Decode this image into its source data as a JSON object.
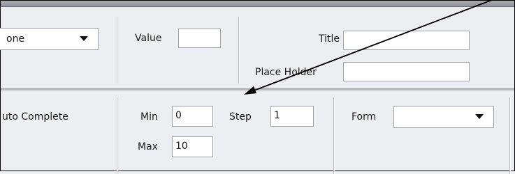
{
  "row1": {
    "type_select_value": "one",
    "value_label": "Value",
    "value_input": "",
    "title_label": "Title",
    "title_input": "",
    "placeholder_label": "Place Holder",
    "placeholder_input": ""
  },
  "row2": {
    "autocomplete_label": "uto Complete",
    "min_label": "Min",
    "min_value": "0",
    "max_label": "Max",
    "max_value": "10",
    "step_label": "Step",
    "step_value": "1",
    "form_label": "Form",
    "form_select_value": ""
  },
  "annotation": {
    "arrow": "callout-arrow pointing to Step field"
  }
}
